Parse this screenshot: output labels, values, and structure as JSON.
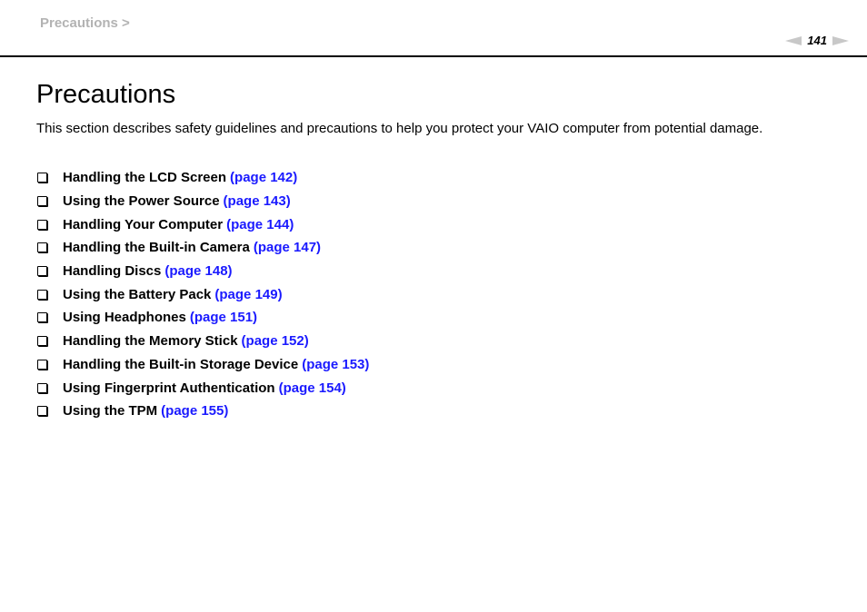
{
  "header": {
    "breadcrumb": "Precautions >",
    "page_number": "141",
    "prev_icon": "triangle-left-icon",
    "next_icon": "triangle-right-icon"
  },
  "main": {
    "title": "Precautions",
    "intro": "This section describes safety guidelines and precautions to help you protect your VAIO computer from potential damage.",
    "link_color": "#1a1aff",
    "items": [
      {
        "label": "Handling the LCD Screen",
        "link": "(page 142)"
      },
      {
        "label": "Using the Power Source",
        "link": "(page 143)"
      },
      {
        "label": "Handling Your Computer",
        "link": "(page 144)"
      },
      {
        "label": "Handling the Built-in Camera",
        "link": "(page 147)"
      },
      {
        "label": "Handling Discs",
        "link": "(page 148)"
      },
      {
        "label": "Using the Battery Pack",
        "link": "(page 149)"
      },
      {
        "label": "Using Headphones",
        "link": "(page 151)"
      },
      {
        "label": "Handling the Memory Stick",
        "link": "(page 152)"
      },
      {
        "label": "Handling the Built-in Storage Device",
        "link": "(page 153)"
      },
      {
        "label": "Using Fingerprint Authentication",
        "link": "(page 154)"
      },
      {
        "label": "Using the TPM",
        "link": "(page 155)"
      }
    ]
  }
}
